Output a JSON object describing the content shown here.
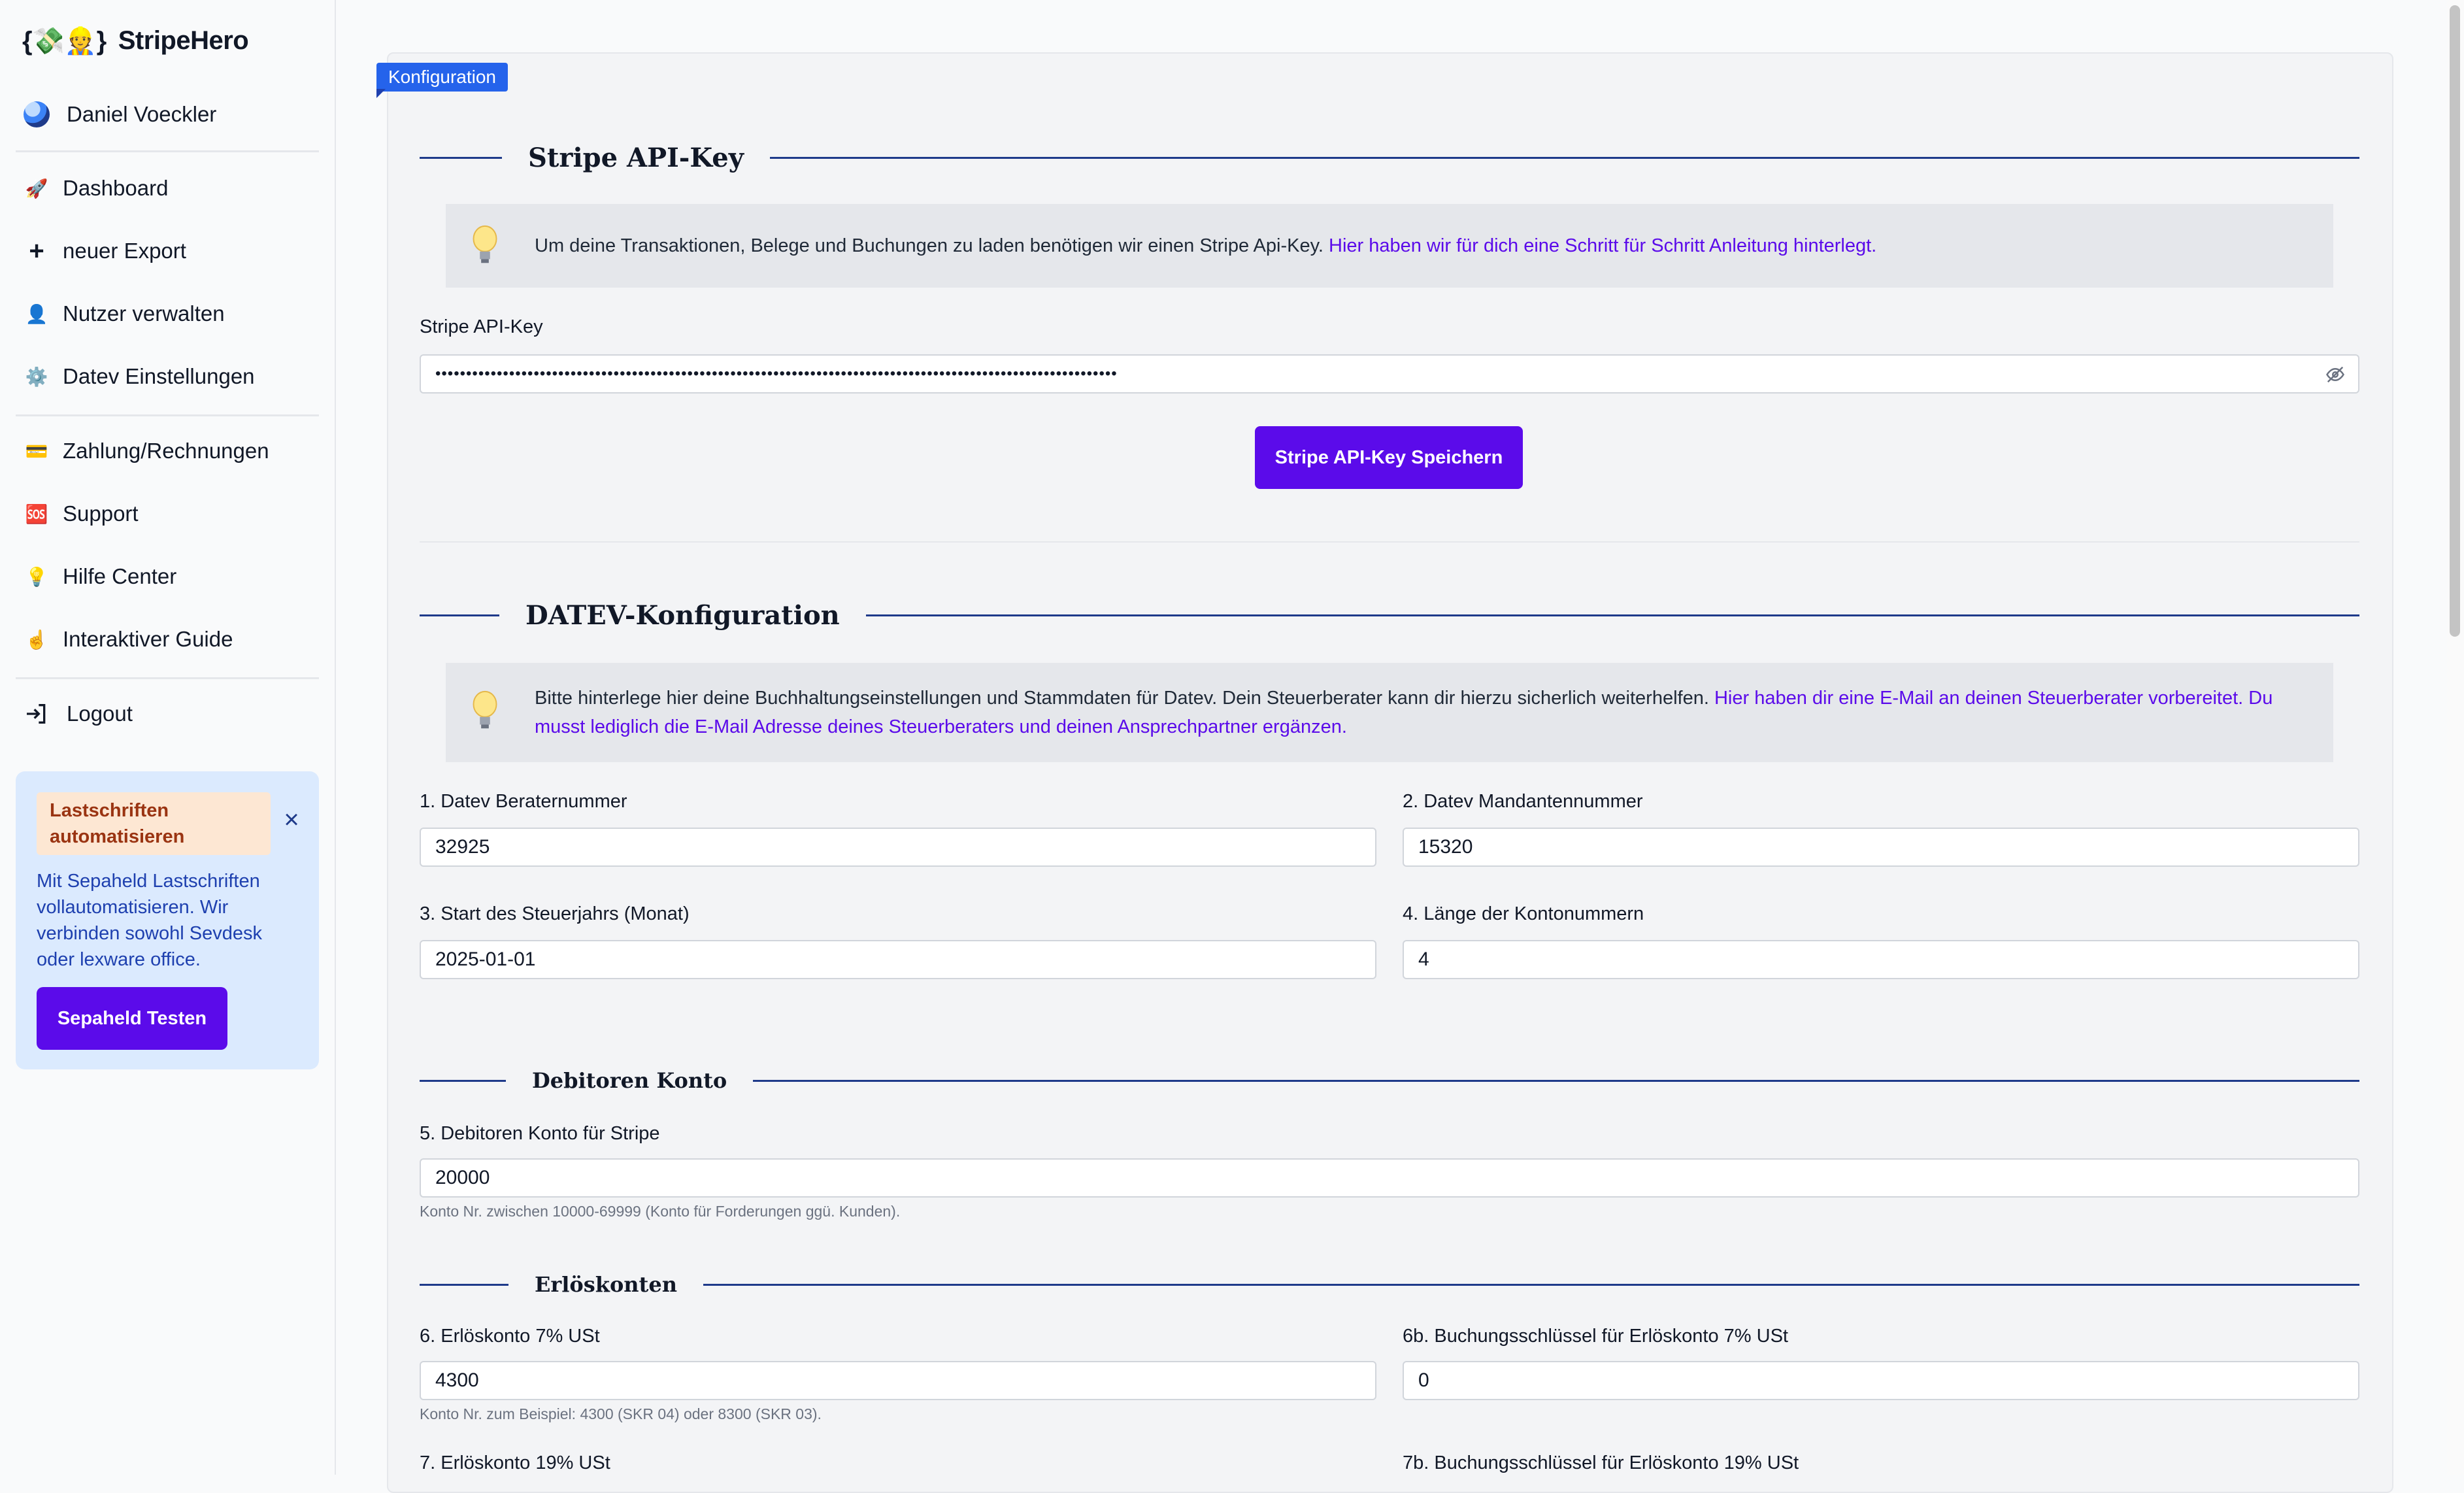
{
  "app": {
    "name": "StripeHero",
    "logo_glyphs": "{💸👷}"
  },
  "user": {
    "name": "Daniel Voeckler"
  },
  "sidebar": {
    "items": [
      {
        "label": "Dashboard",
        "icon": "🚀"
      },
      {
        "label": "neuer Export",
        "icon": "+"
      },
      {
        "label": "Nutzer verwalten",
        "icon": "👤"
      },
      {
        "label": "Datev Einstellungen",
        "icon": "⚙️"
      },
      {
        "label": "Zahlung/Rechnungen",
        "icon": "💳"
      },
      {
        "label": "Support",
        "icon": "🆘"
      },
      {
        "label": "Hilfe Center",
        "icon": "💡"
      },
      {
        "label": "Interaktiver Guide",
        "icon": "☝️"
      },
      {
        "label": "Logout",
        "icon": "logout-icon"
      }
    ]
  },
  "promo": {
    "badge": "Lastschriften automatisieren",
    "text": "Mit Sepaheld Lastschriften vollautomatisieren. Wir verbinden sowohl Sevdesk oder lexware office.",
    "button": "Sepaheld Testen",
    "close": "×"
  },
  "main": {
    "tag": "Konfiguration",
    "stripe": {
      "title": "Stripe API-Key",
      "info": "Um deine Transaktionen, Belege und Buchungen zu laden benötigen wir einen Stripe Api-Key.",
      "info_link": "Hier haben wir für dich eine Schritt für Schritt Anleitung hinterlegt.",
      "field_label": "Stripe API-Key",
      "field_value": "•••••••••••••••••••••••••••••••••••••••••••••••••••••••••••••••••••••••••••••••••••••••••••••••••••••••••••••••",
      "save_button": "Stripe API-Key Speichern"
    },
    "datev": {
      "title": "DATEV-Konfiguration",
      "info": "Bitte hinterlege hier deine Buchhaltungseinstellungen und Stammdaten für Datev. Dein Steuerberater kann dir hierzu sicherlich weiterhelfen.",
      "info_link_1": "Hier haben dir eine E-Mail an deinen Steuerberater vorbereitet. Du",
      "info_link_2": "musst lediglich die E-Mail Adresse deines Steuerberaters und deinen Ansprechpartner ergänzen.",
      "fields": [
        {
          "label": "1. Datev Beraternummer",
          "value": "32925"
        },
        {
          "label": "2. Datev Mandantennummer",
          "value": "15320"
        },
        {
          "label": "3. Start des Steuerjahrs (Monat)",
          "value": "2025-01-01"
        },
        {
          "label": "4. Länge der Kontonummern",
          "value": "4"
        }
      ]
    },
    "debitoren": {
      "title": "Debitoren Konto",
      "label": "5. Debitoren Konto für Stripe",
      "value": "20000",
      "hint": "Konto Nr. zwischen 10000-69999 (Konto für Forderungen ggü. Kunden)."
    },
    "erloes": {
      "title": "Erlöskonten",
      "f6_label": "6. Erlöskonto 7% USt",
      "f6_value": "4300",
      "f6_hint": "Konto Nr. zum Beispiel: 4300 (SKR 04) oder 8300 (SKR 03).",
      "f6b_label": "6b. Buchungsschlüssel für Erlöskonto 7% USt",
      "f6b_value": "0",
      "f7_label": "7. Erlöskonto 19% USt",
      "f7b_label": "7b. Buchungsschlüssel für Erlöskonto 19% USt"
    }
  }
}
